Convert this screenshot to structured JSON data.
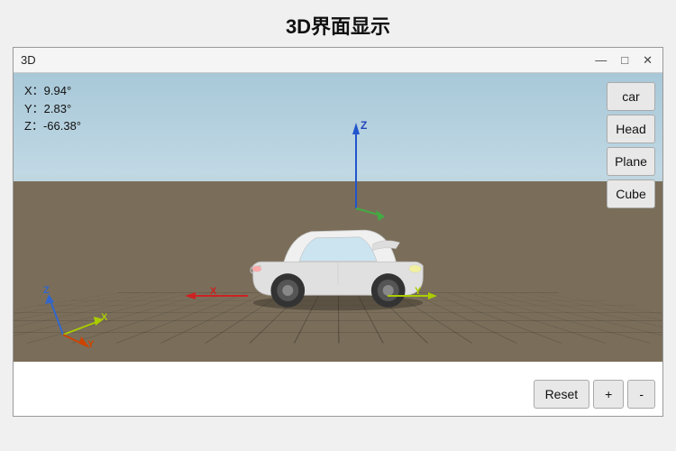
{
  "page": {
    "title": "3D界面显示"
  },
  "titlebar": {
    "title": "3D",
    "minimize": "—",
    "maximize": "□",
    "close": "✕"
  },
  "coords": {
    "x": "X：9.94°",
    "y": "Y：2.83°",
    "z": "Z：-66.38°"
  },
  "sideButtons": [
    {
      "label": "car",
      "name": "car-button"
    },
    {
      "label": "Head",
      "name": "head-button"
    },
    {
      "label": "Plane",
      "name": "plane-button"
    },
    {
      "label": "Cube",
      "name": "cube-button"
    }
  ],
  "bottomButtons": {
    "reset": "Reset",
    "plus": "+",
    "minus": "-"
  }
}
